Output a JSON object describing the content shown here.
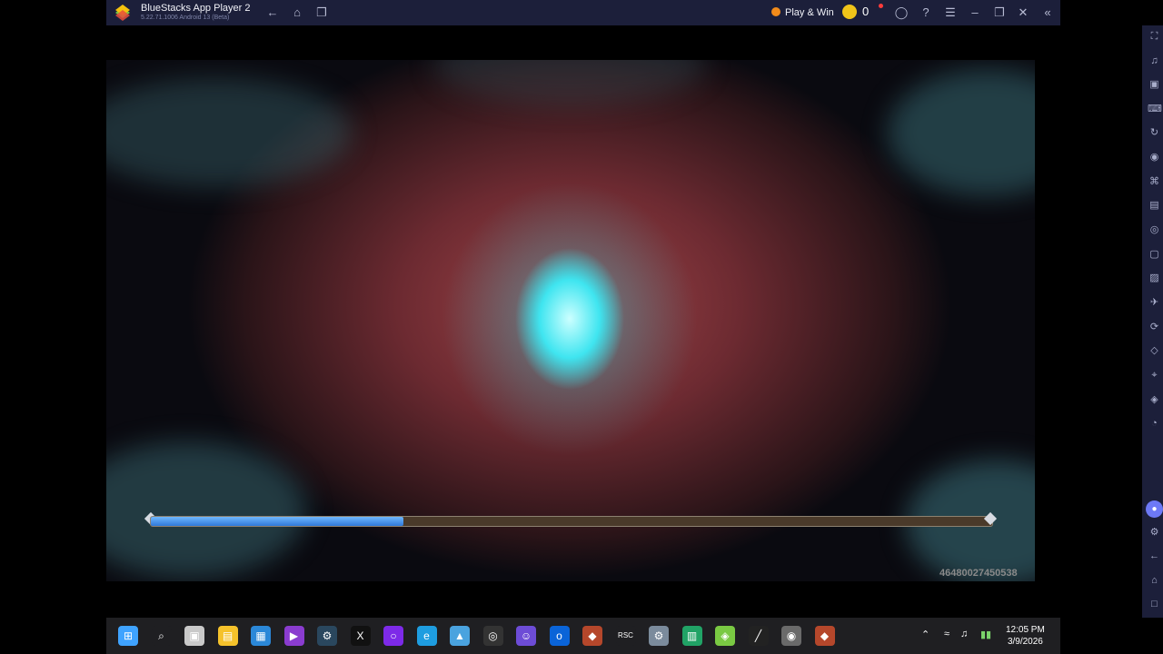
{
  "window": {
    "title": "BlueStacks App Player 2",
    "subtitle": "5.22.71.1006 Android 13 (Beta)",
    "play_win_label": "Play & Win",
    "coin_count": "0"
  },
  "game": {
    "device_id": "46480027450538",
    "loading_progress": 0.3
  },
  "colors": {
    "titlebar": "#1c1f3a",
    "loading_fill": "#3a8ae8",
    "coin": "#f0c419",
    "discord": "#6d79f6"
  },
  "sidebar": {
    "icons": [
      "fullscreen-icon",
      "volume-icon",
      "media-import-icon",
      "keyboard-controls-icon",
      "macro-icon",
      "record-icon",
      "gamepad-icon",
      "apk-icon",
      "screenshot-icon",
      "screen-record-icon",
      "media-folder-icon",
      "airplane-icon",
      "rotate-icon",
      "eraser-icon",
      "location-icon",
      "layers-icon",
      "eco-mode-icon",
      "discord-icon",
      "settings-icon",
      "back-icon",
      "home-icon",
      "recent-apps-icon"
    ]
  },
  "taskbar": {
    "time": "12:05 PM",
    "date": "3/9/2026",
    "apps": [
      "windows-start-icon",
      "search-icon",
      "task-view-icon",
      "file-explorer-icon",
      "store-icon",
      "clipchamp-icon",
      "steam-icon",
      "capcut-icon",
      "cortana-icon",
      "edge-icon",
      "photos-icon",
      "chatgpt-icon",
      "discord-icon",
      "outlook-icon",
      "game-icon",
      "rsc-icon",
      "settings-icon",
      "spreadsheet-icon",
      "bluestacks-icon",
      "pen-icon",
      "bluestacks2-icon",
      "game2-icon"
    ]
  }
}
